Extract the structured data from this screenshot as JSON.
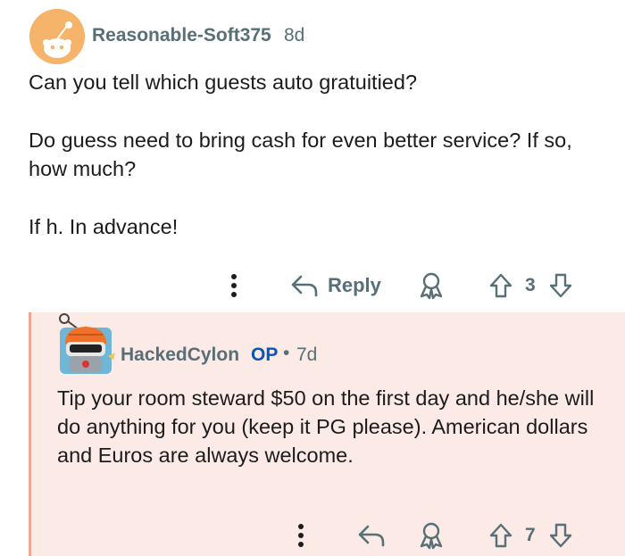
{
  "comment": {
    "username": "Reasonable-Soft375",
    "age": "8d",
    "paragraphs": [
      "Can you tell which guests auto gratuitied?",
      "Do guess need to bring cash for even better service? If so, how much?",
      "If h. In advance!"
    ],
    "actions": {
      "reply_label": "Reply",
      "vote_count": "3"
    }
  },
  "reply": {
    "username": "HackedCylon",
    "op_label": "OP",
    "separator": "•",
    "age": "7d",
    "body": "Tip your room steward $50 on the first day and he/she will do anything for you (keep it PG please). American dollars and Euros are always welcome.",
    "actions": {
      "vote_count": "7"
    }
  },
  "colors": {
    "meta_text": "#576f76",
    "op_blue": "#0a56b8",
    "reply_background": "#fbeae6",
    "thread_line": "#f2a48f",
    "avatar_orange": "#f6b46a"
  },
  "icons": [
    "more-icon",
    "reply-arrow-icon",
    "award-icon",
    "upvote-icon",
    "downvote-icon"
  ]
}
